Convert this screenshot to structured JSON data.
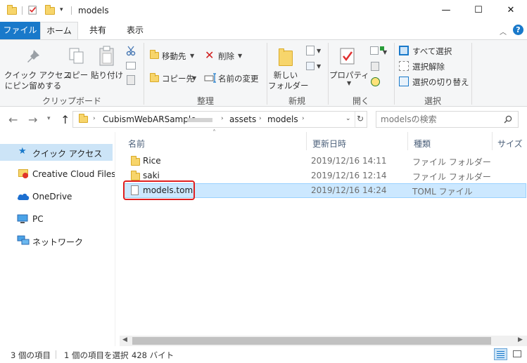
{
  "window": {
    "title": "models",
    "controls": {
      "minimize": "—",
      "maximize": "☐",
      "close": "✕"
    }
  },
  "ribbon_tabs": [
    {
      "label": "ファイル"
    },
    {
      "label": "ホーム"
    },
    {
      "label": "共有"
    },
    {
      "label": "表示"
    }
  ],
  "ribbon": {
    "clipboard": {
      "quick_access_line1": "クイック アクセス",
      "quick_access_line2": "にピン留めする",
      "copy": "コピー",
      "paste": "貼り付け",
      "group_label": "クリップボード"
    },
    "organize": {
      "move_to": "移動先",
      "copy_to": "コピー先",
      "delete": "削除",
      "rename": "名前の変更",
      "group_label": "整理"
    },
    "new": {
      "new_folder_line1": "新しい",
      "new_folder_line2": "フォルダー",
      "group_label": "新規"
    },
    "open": {
      "properties": "プロパティ",
      "group_label": "開く"
    },
    "select": {
      "select_all": "すべて選択",
      "select_none": "選択解除",
      "invert": "選択の切り替え",
      "group_label": "選択"
    }
  },
  "address": {
    "crumbs": [
      "CubismWebARSample-",
      "assets",
      "models"
    ],
    "search_placeholder": "modelsの検索"
  },
  "nav_pane": [
    {
      "label": "クイック アクセス",
      "icon": "star-icon"
    },
    {
      "label": "Creative Cloud Files",
      "icon": "creative-cloud-icon"
    },
    {
      "label": "OneDrive",
      "icon": "cloud-icon"
    },
    {
      "label": "PC",
      "icon": "monitor-icon"
    },
    {
      "label": "ネットワーク",
      "icon": "network-icon"
    }
  ],
  "columns": [
    "名前",
    "更新日時",
    "種類",
    "サイズ"
  ],
  "files": [
    {
      "name": "Rice",
      "date": "2019/12/16 14:11",
      "type": "ファイル フォルダー",
      "icon": "folder-icon"
    },
    {
      "name": "saki",
      "date": "2019/12/16 12:14",
      "type": "ファイル フォルダー",
      "icon": "folder-icon"
    },
    {
      "name": "models.toml",
      "date": "2019/12/16 14:24",
      "type": "TOML ファイル",
      "icon": "file-icon"
    }
  ],
  "status": {
    "item_count": "3 個の項目",
    "selected_info": "1 個の項目を選択",
    "size": "428 バイト"
  }
}
